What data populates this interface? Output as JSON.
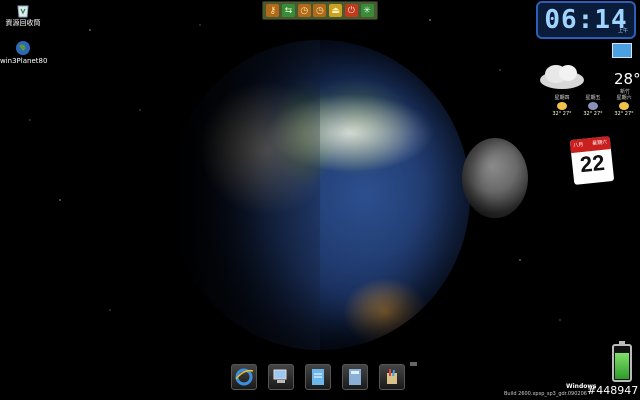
{
  "desktop": {
    "icons": [
      {
        "label": "資源回收筒",
        "icon": "recycle-bin-icon"
      },
      {
        "label": "win3Planet80",
        "icon": "planet-app-icon"
      }
    ]
  },
  "toolbar": {
    "buttons": [
      {
        "icon": "key-icon",
        "glyph": "⚷"
      },
      {
        "icon": "swap-arrows-icon",
        "glyph": "⇆"
      },
      {
        "icon": "clock-icon",
        "glyph": "◷"
      },
      {
        "icon": "clock-alt-icon",
        "glyph": "◷"
      },
      {
        "icon": "eject-icon",
        "glyph": "⏏"
      },
      {
        "icon": "power-icon",
        "glyph": "⏻"
      },
      {
        "icon": "settings-burst-icon",
        "glyph": "✳"
      }
    ]
  },
  "clock": {
    "time": "06:14",
    "ampm": "上午"
  },
  "weather": {
    "temperature": "28°",
    "city": "新竹",
    "forecast": [
      {
        "day": "星期四",
        "temp": "32° 27°"
      },
      {
        "day": "星期五",
        "temp": "32° 27°"
      },
      {
        "day": "星期六",
        "temp": "32° 27°"
      }
    ]
  },
  "calendar": {
    "month": "八月",
    "weekday": "星期六",
    "day": "22"
  },
  "dock": [
    {
      "icon": "internet-explorer-icon"
    },
    {
      "icon": "network-computer-icon"
    },
    {
      "icon": "notepad-icon"
    },
    {
      "icon": "calculator-icon"
    },
    {
      "icon": "paint-icon"
    }
  ],
  "status": {
    "os": "Windows",
    "build": "Build 2600.xpsp_sp3_gdr.090206",
    "watermark": "#448947"
  },
  "battery": {
    "level_percent": 80
  },
  "colors": {
    "toolbar": "#4a5a30",
    "clock_text": "#9fd4ff",
    "calendar_red": "#c91f1f"
  }
}
